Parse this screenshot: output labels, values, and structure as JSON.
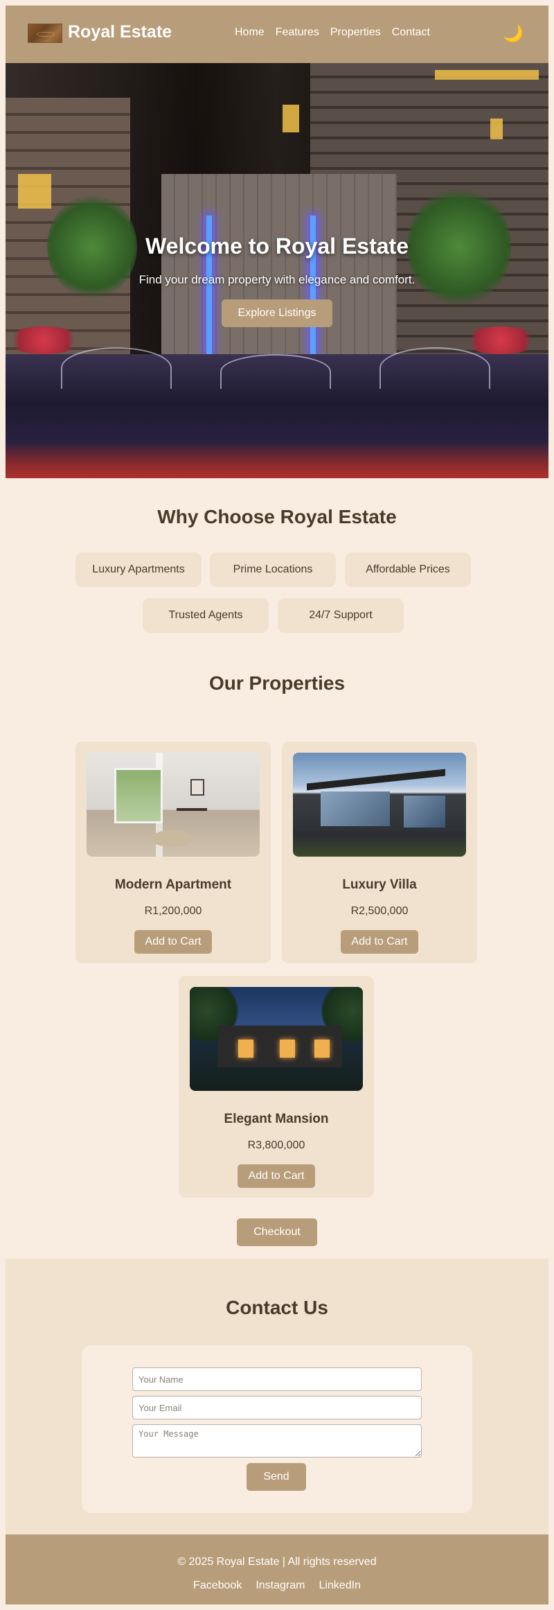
{
  "header": {
    "brand": "Royal Estate",
    "nav": [
      "Home",
      "Features",
      "Properties",
      "Contact"
    ],
    "theme_toggle_icon": "moon-icon"
  },
  "hero": {
    "title": "Welcome to Royal Estate",
    "subtitle": "Find your dream property with elegance and comfort.",
    "button": "Explore Listings"
  },
  "features": {
    "title": "Why Choose Royal Estate",
    "items": [
      "Luxury Apartments",
      "Prime Locations",
      "Affordable Prices",
      "Trusted Agents",
      "24/7 Support"
    ]
  },
  "properties": {
    "title": "Our Properties",
    "items": [
      {
        "name": "Modern Apartment",
        "price": "R1,200,000",
        "button": "Add to Cart"
      },
      {
        "name": "Luxury Villa",
        "price": "R2,500,000",
        "button": "Add to Cart"
      },
      {
        "name": "Elegant Mansion",
        "price": "R3,800,000",
        "button": "Add to Cart"
      }
    ],
    "checkout": "Checkout"
  },
  "contact": {
    "title": "Contact Us",
    "name_placeholder": "Your Name",
    "email_placeholder": "Your Email",
    "message_placeholder": "Your Message",
    "send": "Send"
  },
  "footer": {
    "copyright": "© 2025 Royal Estate | All rights reserved",
    "social": [
      "Facebook",
      "Instagram",
      "LinkedIn"
    ]
  },
  "colors": {
    "background": "#f8ede0",
    "accent": "#b89d7a",
    "card": "#f0e2cf",
    "text": "#4a3a2a"
  }
}
